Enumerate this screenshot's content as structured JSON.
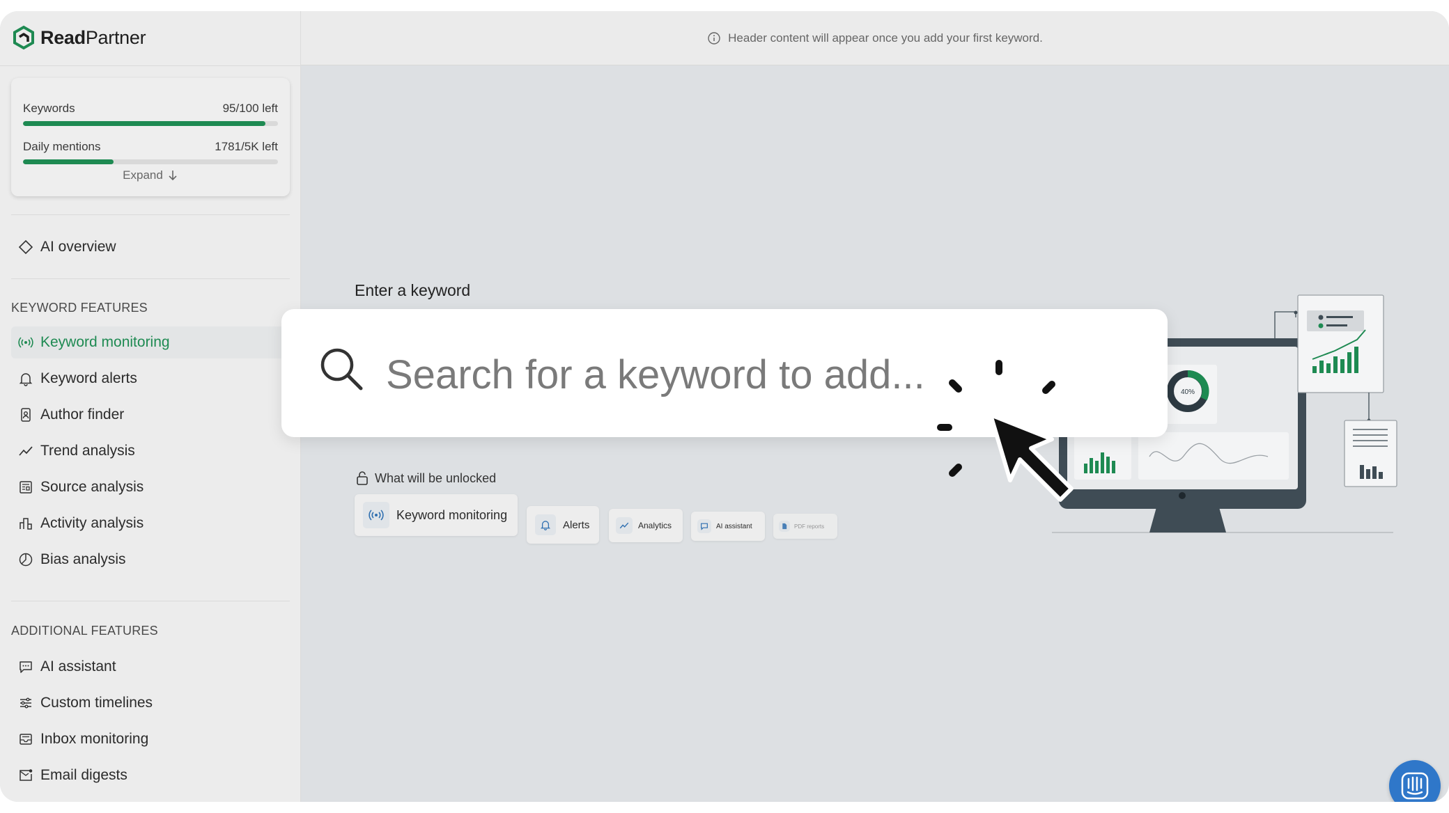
{
  "brand": {
    "name_bold": "Read",
    "name_light": "Partner"
  },
  "header": {
    "message": "Header content will appear once you add your first keyword."
  },
  "usage": {
    "keywords_label": "Keywords",
    "keywords_value": "95/100 left",
    "keywords_fraction": 0.95,
    "mentions_label": "Daily mentions",
    "mentions_value": "1781/5K left",
    "mentions_fraction": 0.3562,
    "expand_label": "Expand"
  },
  "nav": {
    "ai_overview": "AI overview",
    "keyword_section": "KEYWORD FEATURES",
    "keyword_items": [
      {
        "label": "Keyword monitoring",
        "icon": "broadcast-icon"
      },
      {
        "label": "Keyword alerts",
        "icon": "bell-icon"
      },
      {
        "label": "Author finder",
        "icon": "author-icon"
      },
      {
        "label": "Trend analysis",
        "icon": "trend-icon"
      },
      {
        "label": "Source analysis",
        "icon": "newspaper-icon"
      },
      {
        "label": "Activity analysis",
        "icon": "bar-chart-icon"
      },
      {
        "label": "Bias analysis",
        "icon": "pie-icon"
      }
    ],
    "additional_section": "ADDITIONAL FEATURES",
    "additional_items": [
      {
        "label": "AI assistant",
        "icon": "chat-icon"
      },
      {
        "label": "Custom timelines",
        "icon": "sliders-icon"
      },
      {
        "label": "Inbox monitoring",
        "icon": "inbox-icon"
      },
      {
        "label": "Email digests",
        "icon": "mail-icon"
      }
    ]
  },
  "main": {
    "enter_label": "Enter a keyword",
    "search_placeholder": "Search for a keyword to add...",
    "unlock_title": "What will be unlocked",
    "chips": [
      "Keyword monitoring",
      "Alerts",
      "Analytics",
      "AI assistant",
      "PDF reports"
    ],
    "illustration_donut": "40%"
  },
  "colors": {
    "accent_green": "#1e8a52",
    "intercom_blue": "#2f77c9"
  }
}
